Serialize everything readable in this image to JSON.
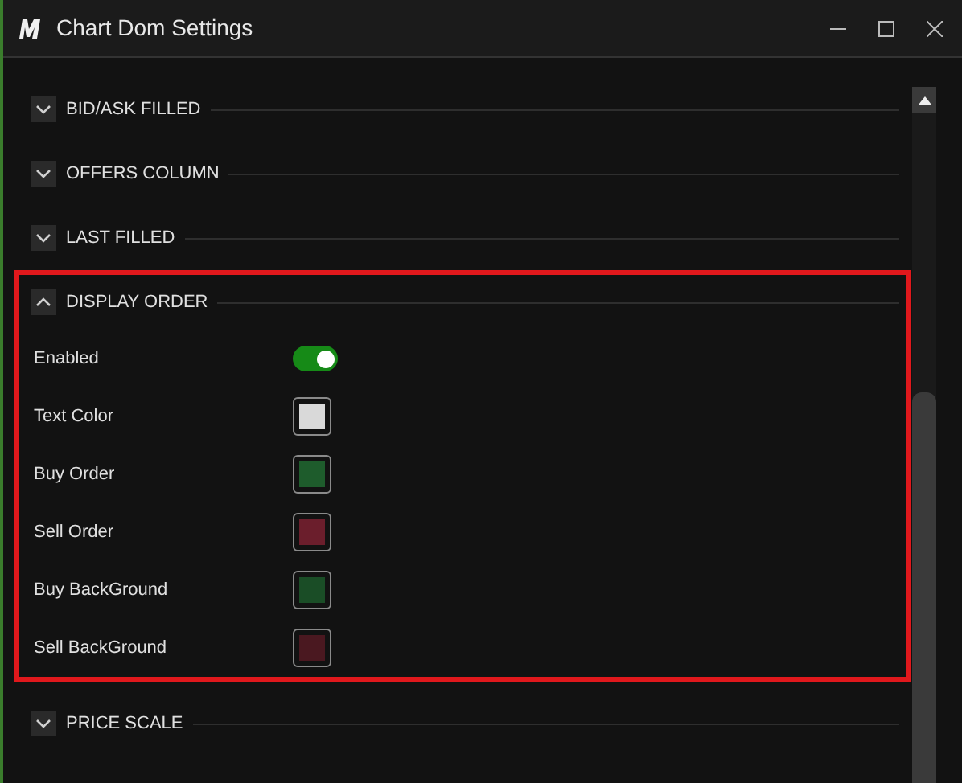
{
  "window": {
    "title": "Chart Dom Settings"
  },
  "sections": [
    {
      "title": "BID/ASK FILLED",
      "expanded": false,
      "highlighted": false
    },
    {
      "title": "OFFERS COLUMN",
      "expanded": false,
      "highlighted": false
    },
    {
      "title": "LAST FILLED",
      "expanded": false,
      "highlighted": false
    },
    {
      "title": "DISPLAY ORDER",
      "expanded": true,
      "highlighted": true,
      "settings": [
        {
          "label": "Enabled",
          "kind": "toggle",
          "on": true
        },
        {
          "label": "Text Color",
          "kind": "color",
          "color": "#d9d9d9"
        },
        {
          "label": "Buy Order",
          "kind": "color",
          "color": "#1e5c2c"
        },
        {
          "label": "Sell Order",
          "kind": "color",
          "color": "#6b1e2c"
        },
        {
          "label": "Buy BackGround",
          "kind": "color",
          "color": "#1a4d26"
        },
        {
          "label": "Sell BackGround",
          "kind": "color",
          "color": "#4a1820"
        }
      ]
    },
    {
      "title": "PRICE SCALE",
      "expanded": false,
      "highlighted": false
    }
  ]
}
